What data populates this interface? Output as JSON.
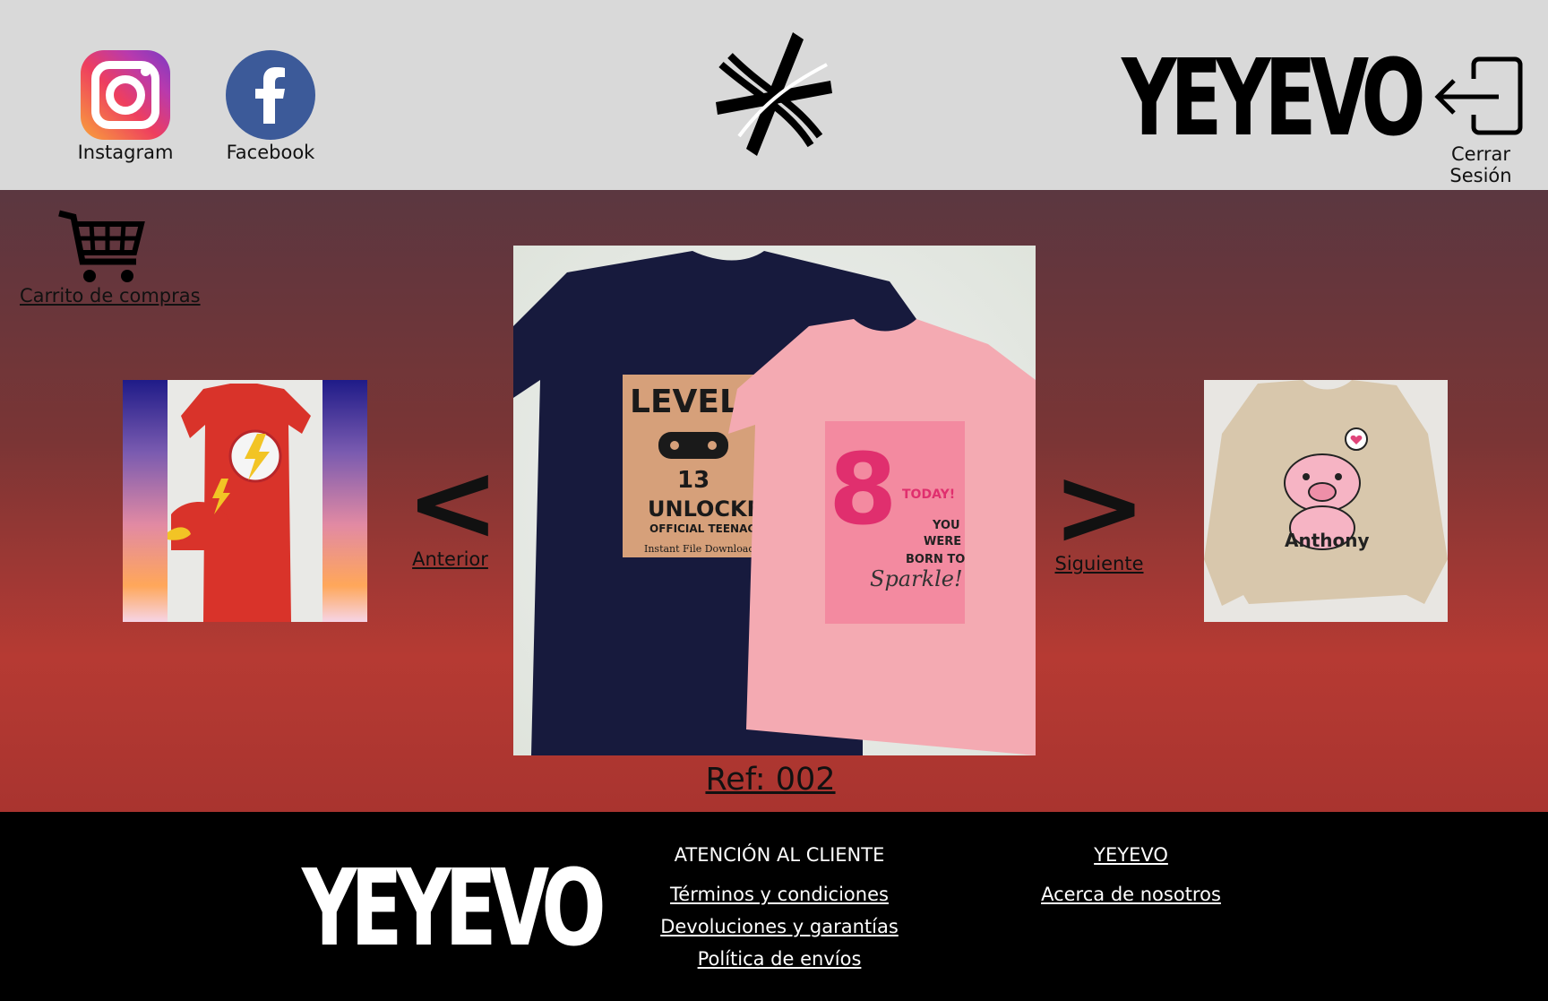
{
  "header": {
    "instagram_label": "Instagram",
    "facebook_label": "Facebook",
    "brand": "YEYEVO",
    "logout_label": "Cerrar Sesión"
  },
  "main": {
    "cart_label": "Carrito de compras",
    "prev_arrow": "<",
    "prev_label": "Anterior",
    "next_arrow": ">",
    "next_label": "Siguiente",
    "ref_label": "Ref: 002"
  },
  "products": {
    "hero_shirt_1": [
      "LEVEL",
      "13",
      "UNLOCKED",
      "OFFICIAL TEENAGER",
      "Instant File Download"
    ],
    "hero_shirt_2": [
      "8",
      "TODAY!",
      "YOU",
      "WERE",
      "BORN TO",
      "Sparkle!"
    ],
    "right_name": "Anthony"
  },
  "footer": {
    "brand": "YEYEVO",
    "col1_head": "ATENCIÓN AL CLIENTE",
    "col1_links": [
      "Términos y condiciones",
      "Devoluciones y garantías",
      "Política de envíos"
    ],
    "col2_head": "YEYEVO",
    "col2_links": [
      "Acerca de nosotros"
    ]
  },
  "colors": {
    "header_bg": "#d9d9d9",
    "facebook_blue": "#3c5a99",
    "footer_bg": "#000000"
  }
}
